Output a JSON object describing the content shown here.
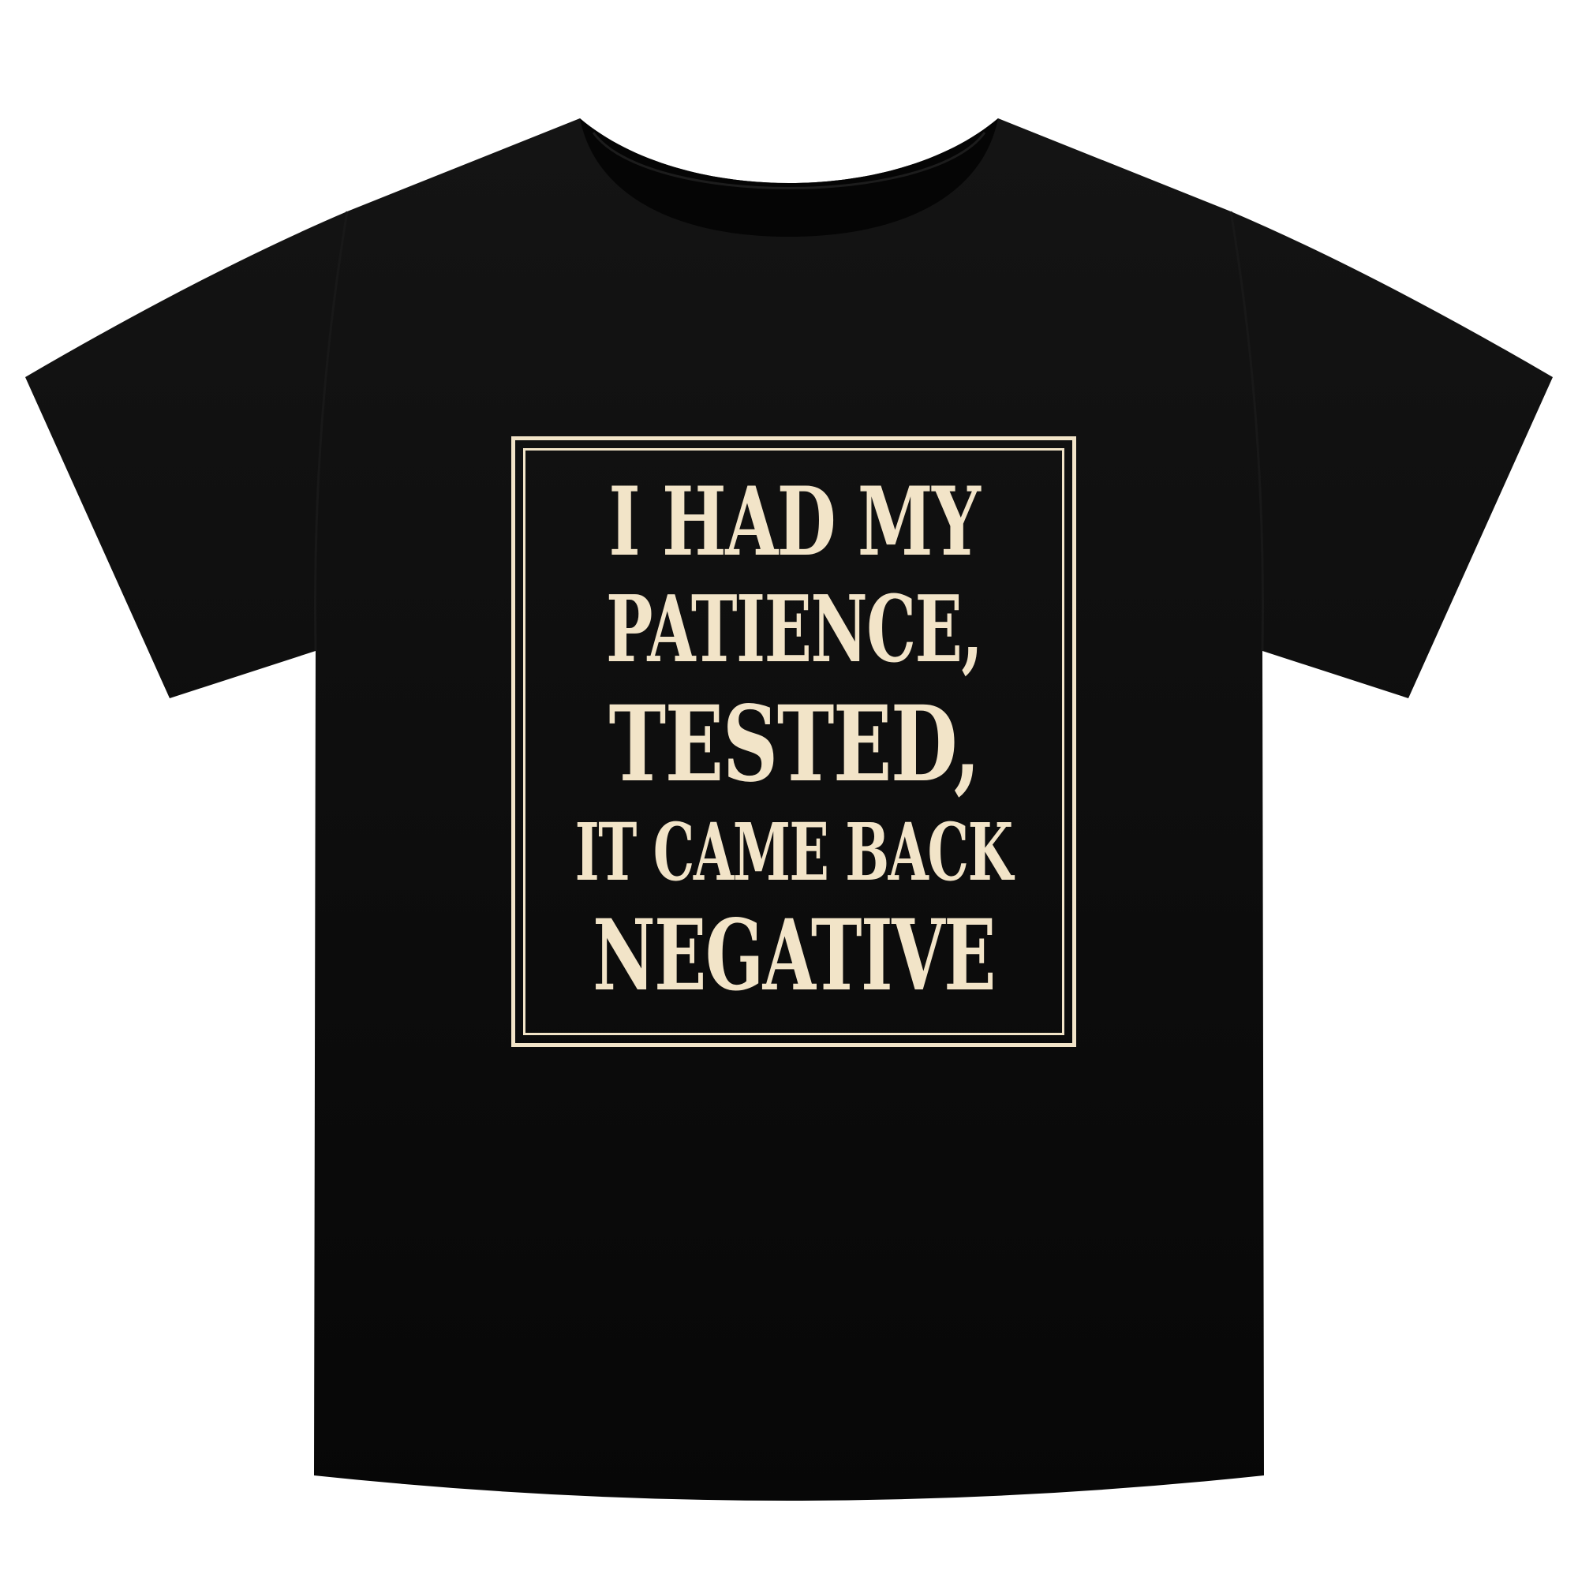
{
  "colors": {
    "background": "#ffffff",
    "shirt": "#0a0a0a",
    "print": "#f2e4c8"
  },
  "design": {
    "lines": [
      "I HAD MY",
      "PATIENCE,",
      "TESTED,",
      "IT CAME BACK",
      "NEGATIVE"
    ]
  }
}
